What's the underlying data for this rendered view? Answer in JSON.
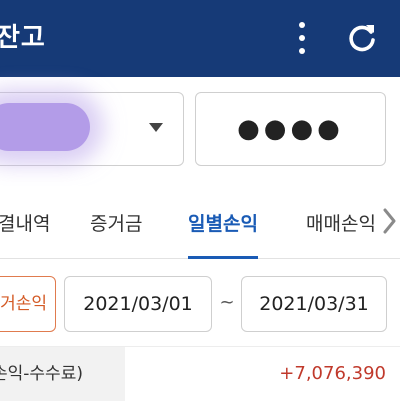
{
  "header": {
    "title": "잔고",
    "menu_icon": "more-vert-icon",
    "refresh_icon": "refresh-icon"
  },
  "account": {
    "selected_account": "",
    "password_mask": "●●●●"
  },
  "tabs": [
    {
      "label": "결내역"
    },
    {
      "label": "증거금"
    },
    {
      "label": "일별손익",
      "active": true
    },
    {
      "label": "매매손익"
    }
  ],
  "filter": {
    "mode_label": "거손익",
    "start_date": "2021/03/01",
    "separator": "~",
    "end_date": "2021/03/31"
  },
  "summary": {
    "label": "손익-수수료)",
    "value": "+7,076,390"
  },
  "colors": {
    "header_bg": "#163a77",
    "accent": "#1a5bb5",
    "filter_accent": "#d45a25",
    "positive": "#c0392b"
  }
}
